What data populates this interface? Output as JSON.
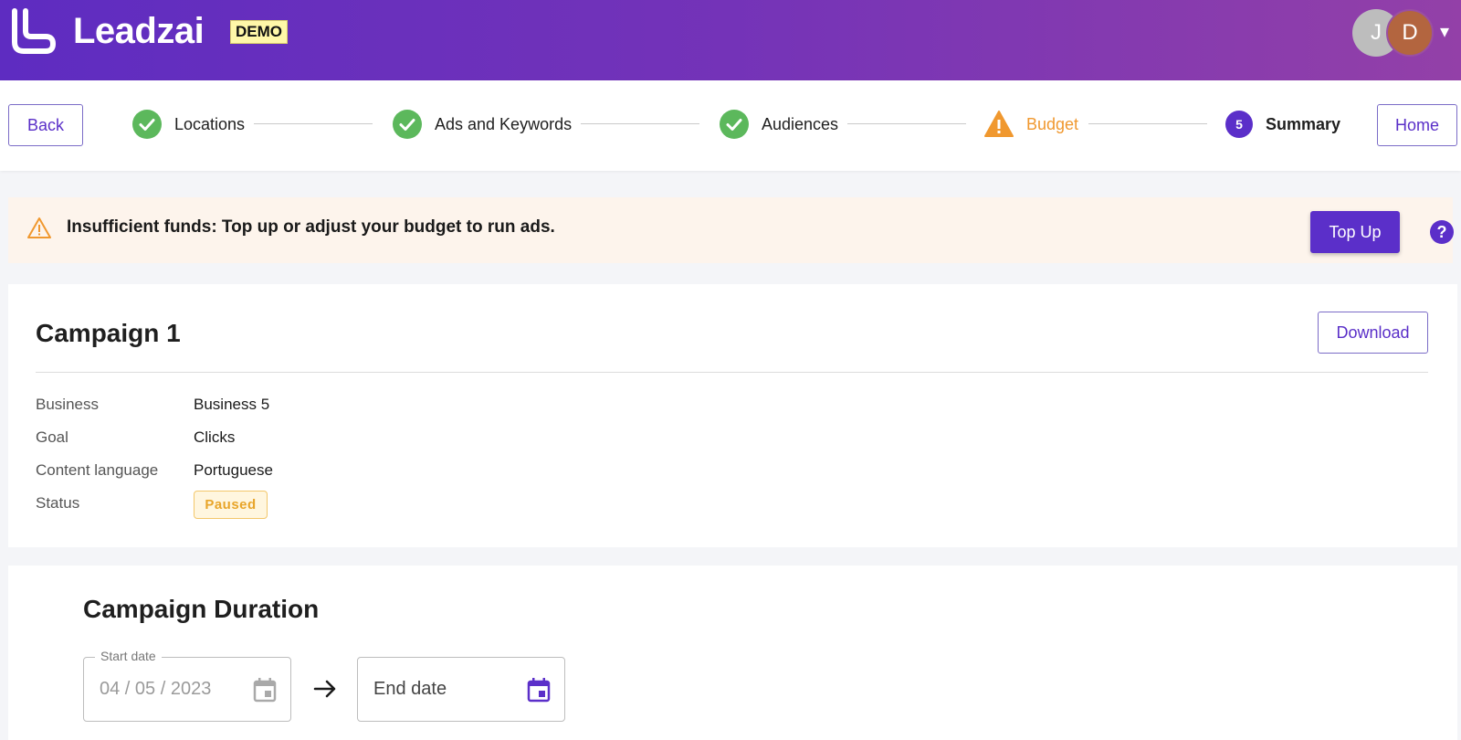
{
  "header": {
    "logo_text": "Leadzai",
    "demo_badge": "DEMO",
    "avatars": [
      {
        "initial": "J",
        "color": "#bdbdbd"
      },
      {
        "initial": "D",
        "color": "#b3653f"
      }
    ],
    "menu_caret": "▾"
  },
  "stepper": {
    "back_label": "Back",
    "home_label": "Home",
    "steps": [
      {
        "label": "Locations",
        "state": "done",
        "icon": "check-circle-icon"
      },
      {
        "label": "Ads and Keywords",
        "state": "done",
        "icon": "check-circle-icon"
      },
      {
        "label": "Audiences",
        "state": "done",
        "icon": "check-circle-icon"
      },
      {
        "label": "Budget",
        "state": "warning",
        "icon": "warning-triangle-icon"
      },
      {
        "label": "Summary",
        "state": "current",
        "number": "5"
      }
    ]
  },
  "alert": {
    "message": "Insufficient funds: Top up or adjust your budget to run ads.",
    "topup_label": "Top Up",
    "help_glyph": "?"
  },
  "campaign": {
    "title": "Campaign 1",
    "download_label": "Download",
    "details": [
      {
        "label": "Business",
        "value": "Business 5"
      },
      {
        "label": "Goal",
        "value": "Clicks"
      },
      {
        "label": "Content language",
        "value": "Portuguese"
      },
      {
        "label": "Status",
        "value": "Paused"
      }
    ]
  },
  "duration": {
    "title": "Campaign Duration",
    "start_legend": "Start date",
    "start_value": "04 / 05 / 2023",
    "end_placeholder": "End date"
  },
  "colors": {
    "accent": "#5b2fc9",
    "success": "#5cb85c",
    "warning": "#f0982f",
    "alert_bg": "#fdf4ec"
  }
}
